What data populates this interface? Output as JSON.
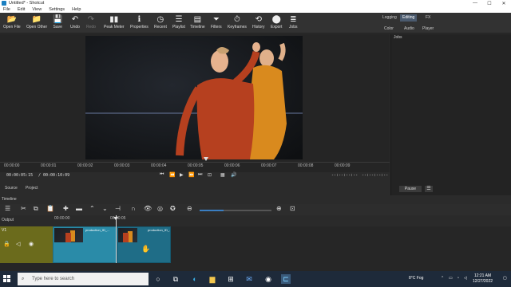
{
  "window": {
    "title": "Untitled* - Shotcut",
    "controls": [
      "—",
      "☐",
      "✕"
    ]
  },
  "menu": [
    "File",
    "Edit",
    "View",
    "Settings",
    "Help"
  ],
  "toolbar": [
    {
      "label": "Open File",
      "icon": "folder-open-icon",
      "glyph": "📂",
      "enabled": true
    },
    {
      "label": "Open Other",
      "icon": "folder-other-icon",
      "glyph": "📁",
      "enabled": true
    },
    {
      "label": "Save",
      "icon": "save-icon",
      "glyph": "💾",
      "enabled": true
    },
    {
      "label": "Undo",
      "icon": "undo-icon",
      "glyph": "↶",
      "enabled": true
    },
    {
      "label": "Redo",
      "icon": "redo-icon",
      "glyph": "↷",
      "enabled": false
    },
    {
      "label": "Peak Meter",
      "icon": "peak-meter-icon",
      "glyph": "▮▮",
      "enabled": true
    },
    {
      "label": "Properties",
      "icon": "properties-icon",
      "glyph": "ℹ",
      "enabled": true
    },
    {
      "label": "Recent",
      "icon": "recent-icon",
      "glyph": "◷",
      "enabled": true
    },
    {
      "label": "Playlist",
      "icon": "playlist-icon",
      "glyph": "☰",
      "enabled": true
    },
    {
      "label": "Timeline",
      "icon": "timeline-icon",
      "glyph": "▤",
      "enabled": true
    },
    {
      "label": "Filters",
      "icon": "filters-icon",
      "glyph": "⏷",
      "enabled": true
    },
    {
      "label": "Keyframes",
      "icon": "keyframes-icon",
      "glyph": "⏱",
      "enabled": true
    },
    {
      "label": "History",
      "icon": "history-icon",
      "glyph": "⟲",
      "enabled": true
    },
    {
      "label": "Export",
      "icon": "export-icon",
      "glyph": "⬤",
      "enabled": true
    },
    {
      "label": "Jobs",
      "icon": "jobs-icon",
      "glyph": "≣",
      "enabled": true
    }
  ],
  "layouts": {
    "tabs": [
      "Logging",
      "Editing",
      "FX"
    ],
    "active": "Editing",
    "sub": [
      "Color",
      "Audio",
      "Player"
    ]
  },
  "player": {
    "ruler_labels": [
      "00:00:00",
      "00:00:01",
      "00:00:02",
      "00:00:03",
      "00:00:04",
      "00:00:05",
      "00:00:06",
      "00:00:07",
      "00:00:08",
      "00:00:09"
    ],
    "current_tc": "00:00:05:15",
    "total_tc": "/ 00:00:10:09",
    "in_point": "--:--:--:--",
    "out_point": "--:--:--:--",
    "tabs": [
      "Source",
      "Project"
    ]
  },
  "jobs": {
    "title": "Jobs",
    "pause_label": "Pause",
    "menu_glyph": "☰"
  },
  "timeline": {
    "title": "Timeline",
    "ruler": [
      "00:00:00",
      "00:00:05"
    ],
    "tracks": [
      {
        "name": "Output"
      },
      {
        "name": "V1"
      }
    ],
    "clips": [
      "production_ID_...",
      "production_ID_..."
    ]
  },
  "taskbar": {
    "search_placeholder": "Type here to search",
    "weather": "8°C  Fog",
    "time": "12:21 AM",
    "date": "12/27/2022",
    "accent": "#1e2a3a"
  }
}
